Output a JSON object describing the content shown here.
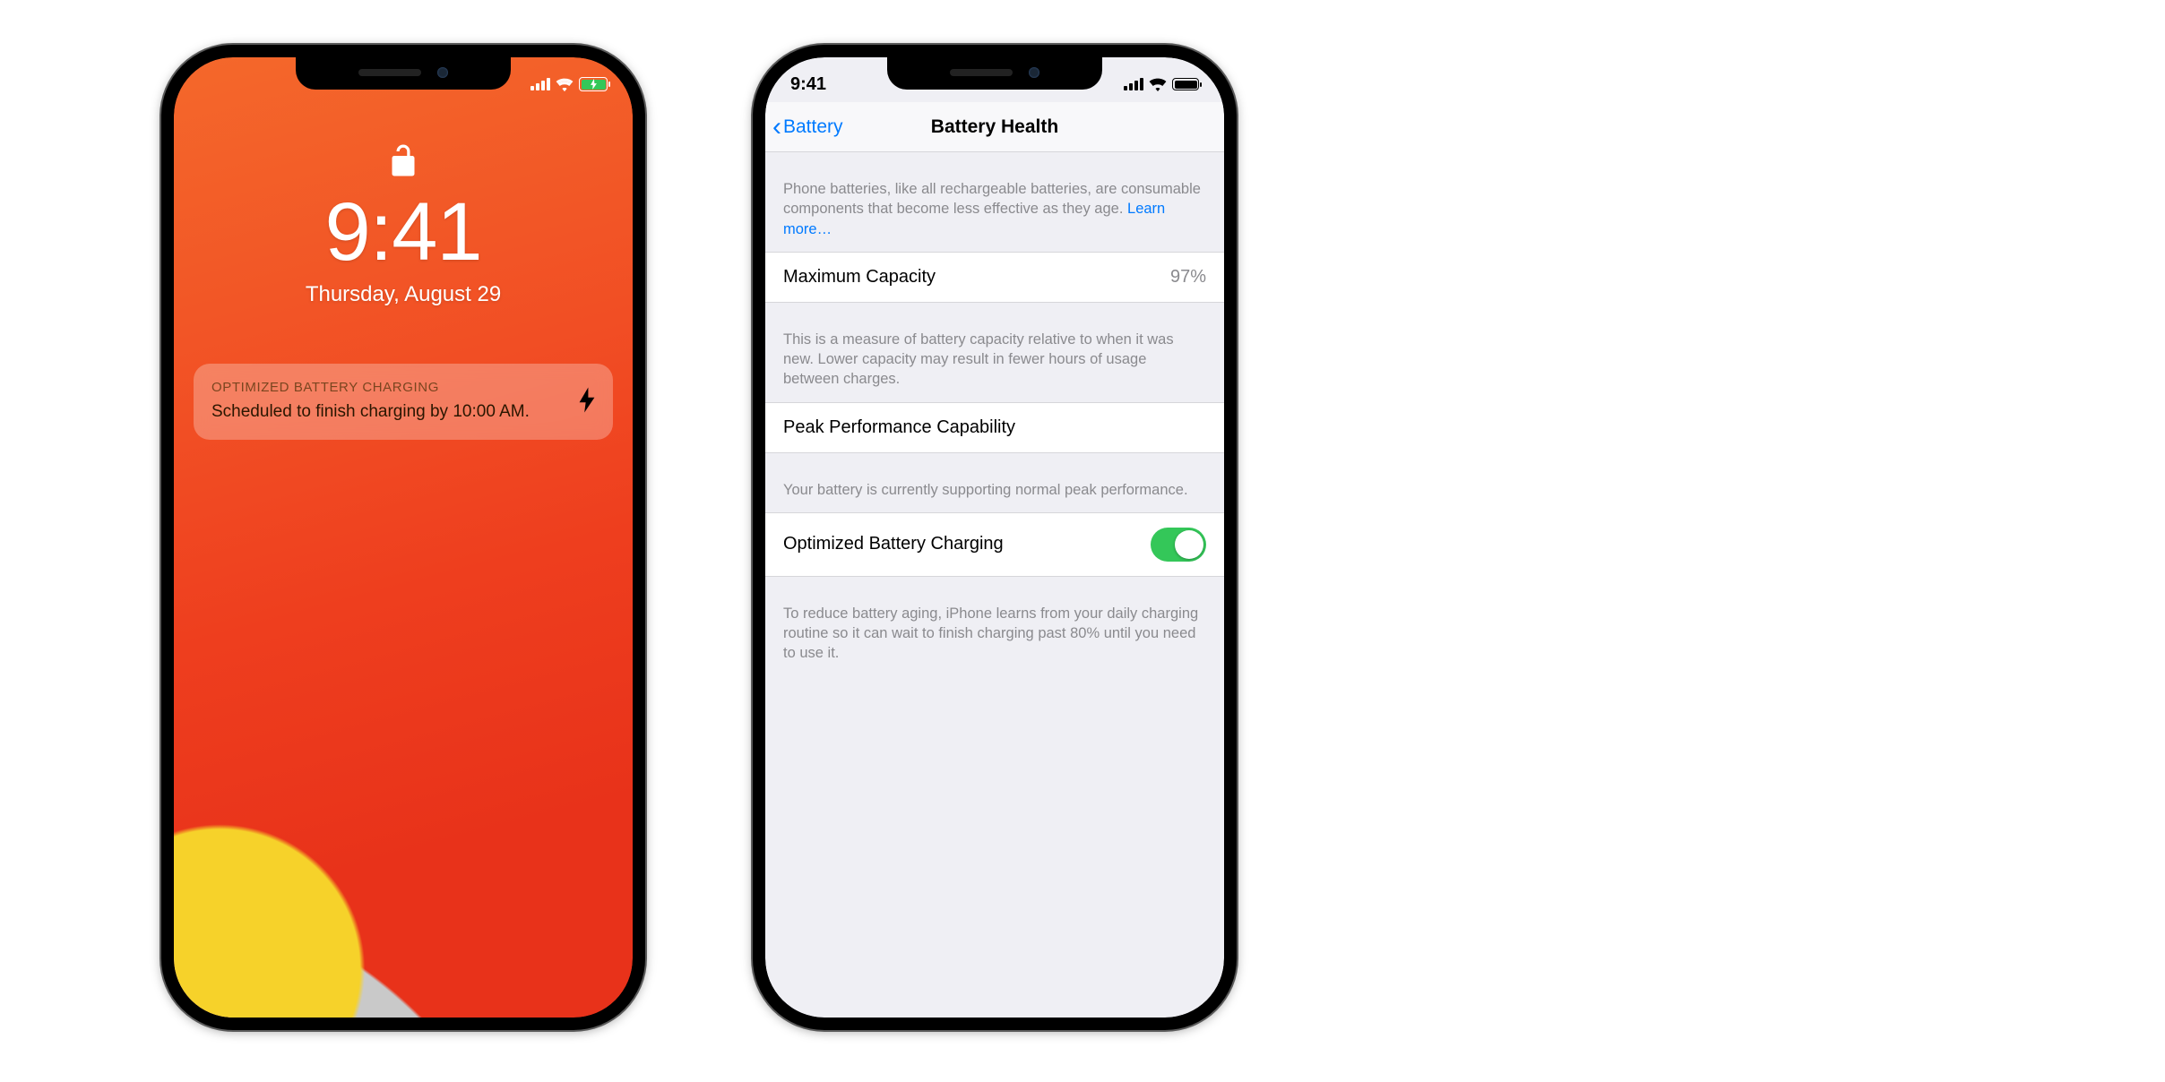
{
  "lock": {
    "status": {
      "signal_alt": "cellular-4-bars",
      "wifi_alt": "wifi",
      "battery_alt": "battery-charging"
    },
    "time": "9:41",
    "date": "Thursday, August 29",
    "notification": {
      "title": "OPTIMIZED BATTERY CHARGING",
      "body": "Scheduled to finish charging by 10:00 AM."
    }
  },
  "settings": {
    "status_time": "9:41",
    "nav": {
      "back": "Battery",
      "title": "Battery Health"
    },
    "intro": {
      "text": "Phone batteries, like all rechargeable batteries, are consumable components that become less effective as they age. ",
      "link": "Learn more…"
    },
    "max_capacity": {
      "label": "Maximum Capacity",
      "value": "97%"
    },
    "max_capacity_note": "This is a measure of battery capacity relative to when it was new. Lower capacity may result in fewer hours of usage between charges.",
    "peak": {
      "label": "Peak Performance Capability"
    },
    "peak_note": "Your battery is currently supporting normal peak performance.",
    "opt": {
      "label": "Optimized Battery Charging",
      "enabled": true
    },
    "opt_note": "To reduce battery aging, iPhone learns from your daily charging routine so it can wait to finish charging past 80% until you need to use it."
  }
}
